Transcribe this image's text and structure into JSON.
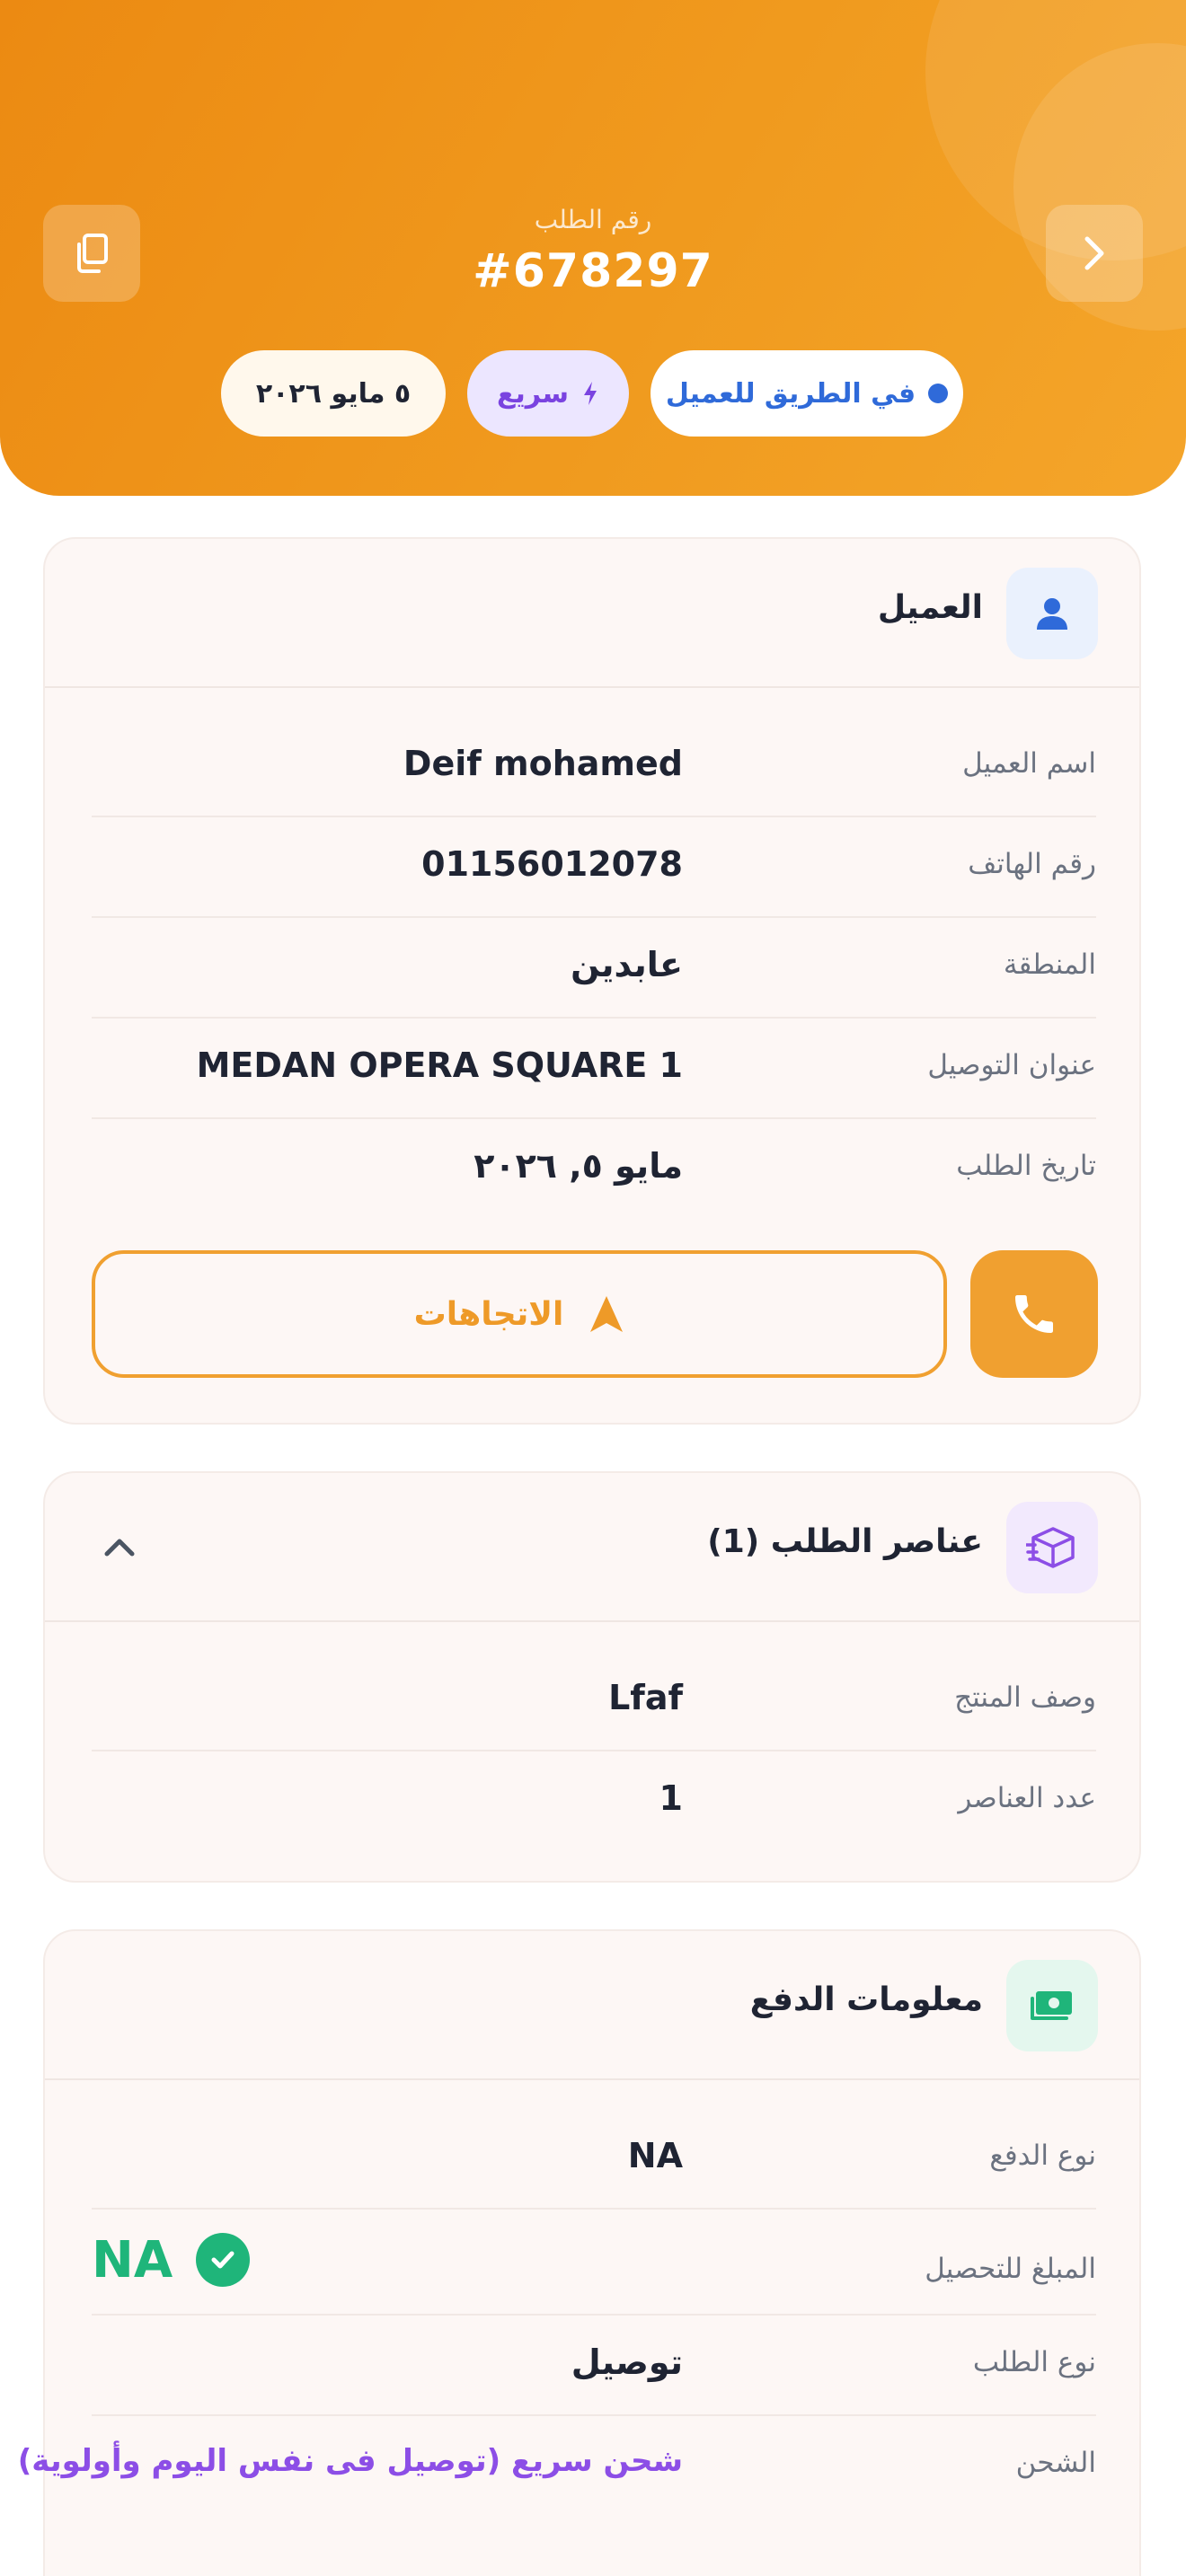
{
  "header": {
    "order_label": "رقم الطلب",
    "order_number": "#678297",
    "badges": {
      "status": "في الطريق للعميل",
      "speed": "سريع",
      "date": "٥ مايو ٢٠٢٦"
    }
  },
  "customer": {
    "title": "العميل",
    "rows": [
      {
        "label": "اسم العميل",
        "value": "Deif mohamed"
      },
      {
        "label": "رقم الهاتف",
        "value": "01156012078"
      },
      {
        "label": "المنطقة",
        "value": "عابدين"
      },
      {
        "label": "عنوان التوصيل",
        "value": "MEDAN OPERA SQUARE 1"
      },
      {
        "label": "تاريخ الطلب",
        "value": "مايو ٥, ٢٠٢٦"
      }
    ],
    "directions_label": "الاتجاهات"
  },
  "items": {
    "title": "عناصر الطلب (1)",
    "rows": [
      {
        "label": "وصف المنتج",
        "value": "Lfaf"
      },
      {
        "label": "عدد العناصر",
        "value": "1"
      }
    ]
  },
  "payment": {
    "title": "معلومات الدفع",
    "rows": [
      {
        "label": "نوع الدفع",
        "value": "NA"
      },
      {
        "label": "المبلغ للتحصيل",
        "value": "NA"
      },
      {
        "label": "نوع الطلب",
        "value": "توصيل"
      },
      {
        "label": "الشحن",
        "value": "شحن سريع (توصيل فى نفس اليوم وأولوية)"
      }
    ]
  },
  "colors": {
    "accent": "#f0a030",
    "status_blue": "#2f6ad9",
    "fast_purple": "#7a43e0",
    "success_green": "#1fb57a"
  }
}
